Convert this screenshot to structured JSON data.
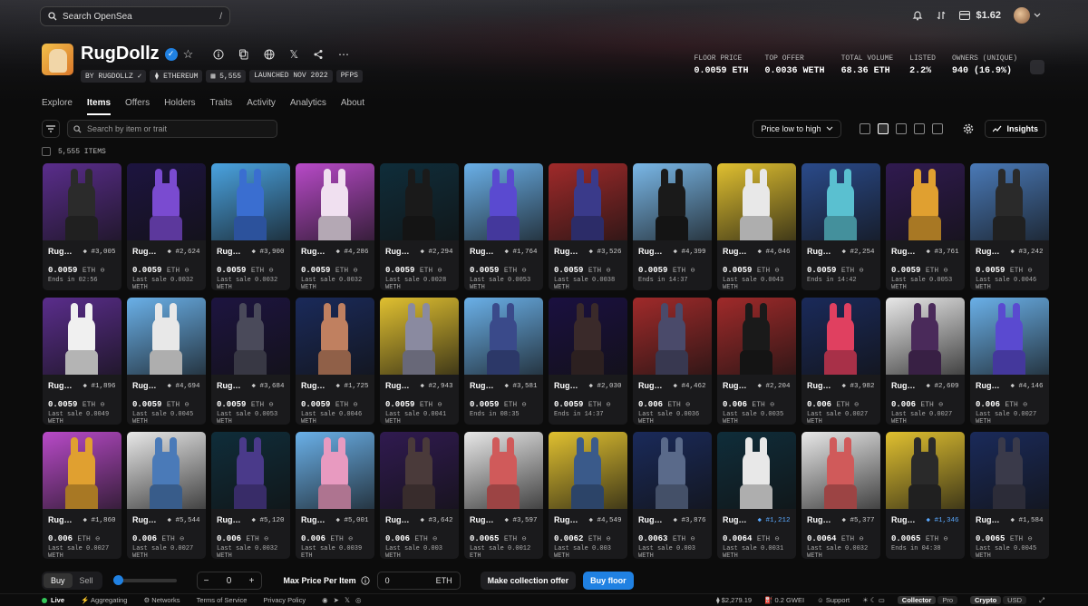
{
  "search": {
    "placeholder": "Search OpenSea",
    "shortcut": "/"
  },
  "wallet": {
    "balance": "$1.62"
  },
  "collection": {
    "name": "RugDollz",
    "tags": [
      "BY RUGDOLLZ",
      "ETHEREUM",
      "5,555",
      "LAUNCHED NOV 2022",
      "PFPS"
    ],
    "stats": [
      {
        "label": "FLOOR PRICE",
        "value": "0.0059 ETH"
      },
      {
        "label": "TOP OFFER",
        "value": "0.0036 WETH"
      },
      {
        "label": "TOTAL VOLUME",
        "value": "68.36 ETH"
      },
      {
        "label": "LISTED",
        "value": "2.2%"
      },
      {
        "label": "OWNERS (UNIQUE)",
        "value": "940 (16.9%)"
      }
    ]
  },
  "tabs": [
    "Explore",
    "Items",
    "Offers",
    "Holders",
    "Traits",
    "Activity",
    "Analytics",
    "About"
  ],
  "filters": {
    "search_placeholder": "Search by item or trait",
    "sort": "Price low to high",
    "insights": "Insights"
  },
  "count": "5,555 ITEMS",
  "items": [
    {
      "name": "Rug…",
      "num": "#3,005",
      "price": "0.0059",
      "cur": "ETH",
      "sub": "Ends in 02:56",
      "bg": "#5a2d8c",
      "fur": "#2b2b2b"
    },
    {
      "name": "Rug…",
      "num": "#2,624",
      "price": "0.0059",
      "cur": "ETH",
      "sub": "Last sale 0.0032 WETH",
      "bg": "#1d1440",
      "fur": "#7a4bd0"
    },
    {
      "name": "Rug…",
      "num": "#3,900",
      "price": "0.0059",
      "cur": "ETH",
      "sub": "Last sale 0.0032 WETH",
      "bg": "#4aa3e0",
      "fur": "#3a6ed0"
    },
    {
      "name": "Rug…",
      "num": "#4,286",
      "price": "0.0059",
      "cur": "ETH",
      "sub": "Last sale 0.0032 WETH",
      "bg": "#b84ac8",
      "fur": "#f0e0f0"
    },
    {
      "name": "Rug…",
      "num": "#2,294",
      "price": "0.0059",
      "cur": "ETH",
      "sub": "Last sale 0.0028 WETH",
      "bg": "#0f2d3a",
      "fur": "#1a1a1a"
    },
    {
      "name": "Rug…",
      "num": "#1,764",
      "price": "0.0059",
      "cur": "ETH",
      "sub": "Last sale 0.0053 WETH",
      "bg": "#6ab0e8",
      "fur": "#5a4ad0"
    },
    {
      "name": "Rug…",
      "num": "#3,526",
      "price": "0.0059",
      "cur": "ETH",
      "sub": "Last sale 0.0038 WETH",
      "bg": "#a02a2a",
      "fur": "#3a3a8a"
    },
    {
      "name": "Rug…",
      "num": "#4,399",
      "price": "0.0059",
      "cur": "ETH",
      "sub": "Ends in 14:37",
      "bg": "#7ab8e8",
      "fur": "#1a1a1a"
    },
    {
      "name": "Rug…",
      "num": "#4,046",
      "price": "0.0059",
      "cur": "ETH",
      "sub": "Last sale 0.0043 WETH",
      "bg": "#e0c030",
      "fur": "#e8e8e8"
    },
    {
      "name": "Rug…",
      "num": "#2,254",
      "price": "0.0059",
      "cur": "ETH",
      "sub": "Ends in 14:42",
      "bg": "#2a4a8a",
      "fur": "#5ac0d0"
    },
    {
      "name": "Rug…",
      "num": "#3,761",
      "price": "0.0059",
      "cur": "ETH",
      "sub": "Last sale 0.0053 WETH",
      "bg": "#301a50",
      "fur": "#e0a030"
    },
    {
      "name": "Rug…",
      "num": "#3,242",
      "price": "0.0059",
      "cur": "ETH",
      "sub": "Last sale 0.0046 WETH",
      "bg": "#4a7ab8",
      "fur": "#2a2a2a"
    },
    {
      "name": "Rug…",
      "num": "#1,896",
      "price": "0.0059",
      "cur": "ETH",
      "sub": "Last sale 0.0049 WETH",
      "bg": "#5a2d8c",
      "fur": "#f0f0f0"
    },
    {
      "name": "Rug…",
      "num": "#4,694",
      "price": "0.0059",
      "cur": "ETH",
      "sub": "Last sale 0.0045 WETH",
      "bg": "#6ab0e8",
      "fur": "#e8e8e8"
    },
    {
      "name": "Rug…",
      "num": "#3,684",
      "price": "0.0059",
      "cur": "ETH",
      "sub": "Last sale 0.0053 WETH",
      "bg": "#1d1440",
      "fur": "#4a4a5a"
    },
    {
      "name": "Rug…",
      "num": "#1,725",
      "price": "0.0059",
      "cur": "ETH",
      "sub": "Last sale 0.0046 WETH",
      "bg": "#1a2a5a",
      "fur": "#c08060"
    },
    {
      "name": "Rug…",
      "num": "#2,943",
      "price": "0.0059",
      "cur": "ETH",
      "sub": "Last sale 0.0041 WETH",
      "bg": "#e0c030",
      "fur": "#8a8aa0"
    },
    {
      "name": "Rug…",
      "num": "#3,581",
      "price": "0.0059",
      "cur": "ETH",
      "sub": "Ends in 08:35",
      "bg": "#6ab0e8",
      "fur": "#3a4a8a"
    },
    {
      "name": "Rug…",
      "num": "#2,030",
      "price": "0.0059",
      "cur": "ETH",
      "sub": "Ends in 14:37",
      "bg": "#1a1040",
      "fur": "#3a2a2a"
    },
    {
      "name": "Rug…",
      "num": "#4,462",
      "price": "0.006",
      "cur": "ETH",
      "sub": "Last sale 0.0036 WETH",
      "bg": "#a02a2a",
      "fur": "#4a4a6a"
    },
    {
      "name": "Rug…",
      "num": "#2,204",
      "price": "0.006",
      "cur": "ETH",
      "sub": "Last sale 0.0035 WETH",
      "bg": "#a02a2a",
      "fur": "#1a1a1a"
    },
    {
      "name": "Rug…",
      "num": "#3,982",
      "price": "0.006",
      "cur": "ETH",
      "sub": "Last sale 0.0027 WETH",
      "bg": "#1a2a5a",
      "fur": "#e04060"
    },
    {
      "name": "Rug…",
      "num": "#2,609",
      "price": "0.006",
      "cur": "ETH",
      "sub": "Last sale 0.0027 WETH",
      "bg": "#e8e8e8",
      "fur": "#4a2a5a"
    },
    {
      "name": "Rug…",
      "num": "#4,146",
      "price": "0.006",
      "cur": "ETH",
      "sub": "Last sale 0.0027 WETH",
      "bg": "#6ab0e8",
      "fur": "#5a4ad0"
    },
    {
      "name": "Rug…",
      "num": "#1,860",
      "price": "0.006",
      "cur": "ETH",
      "sub": "Last sale 0.0027 WETH",
      "bg": "#b84ac8",
      "fur": "#e0a030"
    },
    {
      "name": "Rug…",
      "num": "#5,544",
      "price": "0.006",
      "cur": "ETH",
      "sub": "Last sale 0.0027 WETH",
      "bg": "#e8e8e8",
      "fur": "#4a7ab8"
    },
    {
      "name": "Rug…",
      "num": "#5,120",
      "price": "0.006",
      "cur": "ETH",
      "sub": "Last sale 0.0032 WETH",
      "bg": "#0f2d3a",
      "fur": "#4a3a8a"
    },
    {
      "name": "Rug…",
      "num": "#5,001",
      "price": "0.006",
      "cur": "ETH",
      "sub": "Last sale 0.0039 ETH",
      "bg": "#6ab0e8",
      "fur": "#e89ac0"
    },
    {
      "name": "Rug…",
      "num": "#3,642",
      "price": "0.006",
      "cur": "ETH",
      "sub": "Last sale 0.003 WETH",
      "bg": "#301a50",
      "fur": "#4a3a3a"
    },
    {
      "name": "Rug…",
      "num": "#3,597",
      "price": "0.0065",
      "cur": "ETH",
      "sub": "Last sale 0.0012 ETH",
      "bg": "#e8e8e8",
      "fur": "#d05a5a"
    },
    {
      "name": "Rug…",
      "num": "#4,549",
      "price": "0.0062",
      "cur": "ETH",
      "sub": "Last sale 0.003 WETH",
      "bg": "#e0c030",
      "fur": "#3a5a8a"
    },
    {
      "name": "Rug…",
      "num": "#3,876",
      "price": "0.0063",
      "cur": "ETH",
      "sub": "Last sale 0.003 WETH",
      "bg": "#1a2a5a",
      "fur": "#5a6a8a"
    },
    {
      "name": "Rug…",
      "num": "#1,212",
      "numBlue": true,
      "price": "0.0064",
      "cur": "ETH",
      "sub": "Last sale 0.0031 WETH",
      "bg": "#0f2d3a",
      "fur": "#e8e8e8"
    },
    {
      "name": "Rug…",
      "num": "#5,377",
      "price": "0.0064",
      "cur": "ETH",
      "sub": "Last sale 0.0032 WETH",
      "bg": "#e8e8e8",
      "fur": "#d05a5a"
    },
    {
      "name": "Rug…",
      "num": "#1,346",
      "numBlue": true,
      "price": "0.0065",
      "cur": "ETH",
      "sub": "Ends in 04:38",
      "bg": "#e0c030",
      "fur": "#2a2a2a"
    },
    {
      "name": "Rug…",
      "num": "#1,584",
      "price": "0.0065",
      "cur": "ETH",
      "sub": "Last sale 0.0045 WETH",
      "bg": "#1a2a5a",
      "fur": "#3a3a4a"
    }
  ],
  "bottom": {
    "buy": "Buy",
    "sell": "Sell",
    "qty": "0",
    "max_label": "Max Price Per Item",
    "price_val": "0",
    "price_cur": "ETH",
    "offer": "Make collection offer",
    "buyfloor": "Buy floor"
  },
  "footer": {
    "live": "Live",
    "aggregating": "Aggregating",
    "networks": "Networks",
    "terms": "Terms of Service",
    "privacy": "Privacy Policy",
    "eth_price": "$2,279.19",
    "gas": "0.2 GWEI",
    "support": "Support",
    "collector": "Collector",
    "pro": "Pro",
    "crypto": "Crypto",
    "usd": "USD"
  }
}
